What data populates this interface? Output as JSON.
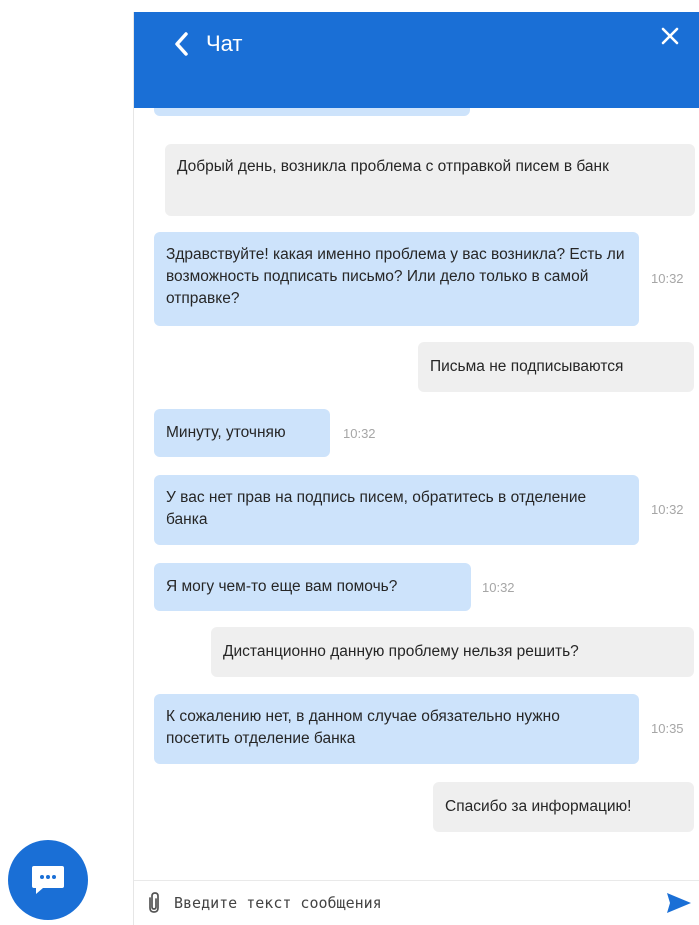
{
  "header": {
    "title": "Чат",
    "back_icon": "chevron-left-icon",
    "close_icon": "close-icon"
  },
  "messages": [
    {
      "from": "user",
      "text": "Добрый день, возникла проблема с отправкой писем в банк",
      "time": ""
    },
    {
      "from": "bot",
      "text": "Здравствуйте! какая именно проблема у вас возникла? Есть ли возможность подписать письмо? Или дело только в самой отправке?",
      "time": "10:32"
    },
    {
      "from": "user",
      "text": "Письма не подписываются",
      "time": ""
    },
    {
      "from": "bot",
      "text": "Минуту, уточняю",
      "time": "10:32"
    },
    {
      "from": "bot",
      "text": "У вас нет прав на подпись писем, обратитесь в отделение банка",
      "time": "10:32"
    },
    {
      "from": "bot",
      "text": "Я могу чем-то еще вам помочь?",
      "time": "10:32"
    },
    {
      "from": "user",
      "text": "Дистанционно данную проблему нельзя решить?",
      "time": ""
    },
    {
      "from": "bot",
      "text": "К сожалению нет, в данном случае обязательно нужно посетить отделение банка",
      "time": "10:35"
    },
    {
      "from": "user",
      "text": "Спасибо за информацию!",
      "time": ""
    }
  ],
  "composer": {
    "placeholder": "Введите текст сообщения",
    "value": "",
    "attach_icon": "paperclip-icon",
    "send_icon": "send-icon"
  },
  "launcher": {
    "icon": "chat-bubble-icon"
  },
  "colors": {
    "brand": "#1a6fd6",
    "bot_bubble": "#cde3fb",
    "user_bubble": "#efefef",
    "timestamp": "#a6a6a6"
  }
}
